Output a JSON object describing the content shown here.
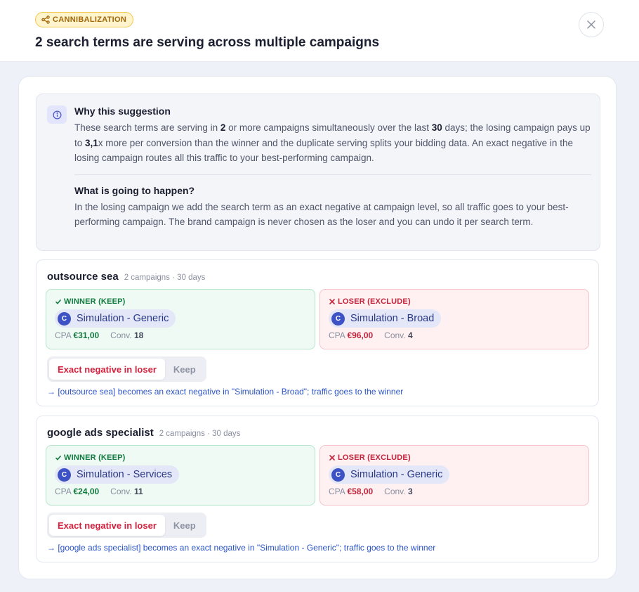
{
  "header": {
    "badge": "CANNIBALIZATION",
    "title": "2 search terms are serving across multiple campaigns"
  },
  "info": {
    "why_title": "Why this suggestion",
    "why_p1": "These search terms are serving in ",
    "why_n1": "2",
    "why_p2": " or more campaigns simultaneously over the last ",
    "why_n2": "30",
    "why_p3": " days; the losing campaign pays up to ",
    "why_n3": "3,1",
    "why_p4": "x more per conversion than the winner and the duplicate serving splits your bidding data. An exact negative in the losing campaign routes all this traffic to your best-performing campaign.",
    "what_title": "What is going to happen?",
    "what_text": "In the losing campaign we add the search term as an exact negative at campaign level, so all traffic goes to your best-performing campaign. The brand campaign is never chosen as the loser and you can undo it per search term."
  },
  "groups": [
    {
      "term": "outsource sea",
      "meta": "2 campaigns · 30 days",
      "winner": {
        "label": "WINNER (KEEP)",
        "avatar": "C",
        "campaign": "Simulation - Generic",
        "cpa_label": "CPA",
        "cpa": "€31,00",
        "conv_label": "Conv.",
        "conv": "18"
      },
      "loser": {
        "label": "LOSER (EXCLUDE)",
        "avatar": "C",
        "campaign": "Simulation - Broad",
        "cpa_label": "CPA",
        "cpa": "€96,00",
        "conv_label": "Conv.",
        "conv": "4"
      },
      "toggle_active": "Exact negative in loser",
      "toggle_inactive": "Keep",
      "explain": "→ [outsource sea] becomes an exact negative in \"Simulation - Broad\"; traffic goes to the winner"
    },
    {
      "term": "google ads specialist",
      "meta": "2 campaigns · 30 days",
      "winner": {
        "label": "WINNER (KEEP)",
        "avatar": "C",
        "campaign": "Simulation - Services",
        "cpa_label": "CPA",
        "cpa": "€24,00",
        "conv_label": "Conv.",
        "conv": "11"
      },
      "loser": {
        "label": "LOSER (EXCLUDE)",
        "avatar": "C",
        "campaign": "Simulation - Generic",
        "cpa_label": "CPA",
        "cpa": "€58,00",
        "conv_label": "Conv.",
        "conv": "3"
      },
      "toggle_active": "Exact negative in loser",
      "toggle_inactive": "Keep",
      "explain": "→ [google ads specialist] becomes an exact negative in \"Simulation - Generic\"; traffic goes to the winner"
    }
  ],
  "icons": {
    "badge": "share-nodes-icon",
    "close": "close-icon",
    "info": "info-icon",
    "winner": "check-icon",
    "loser": "x-icon"
  },
  "colors": {
    "badge_bg": "#fff4cc",
    "winner_accent": "#117a3f",
    "loser_accent": "#c4243b",
    "link": "#2c55c7",
    "campaign_avatar": "#3d52c4"
  }
}
